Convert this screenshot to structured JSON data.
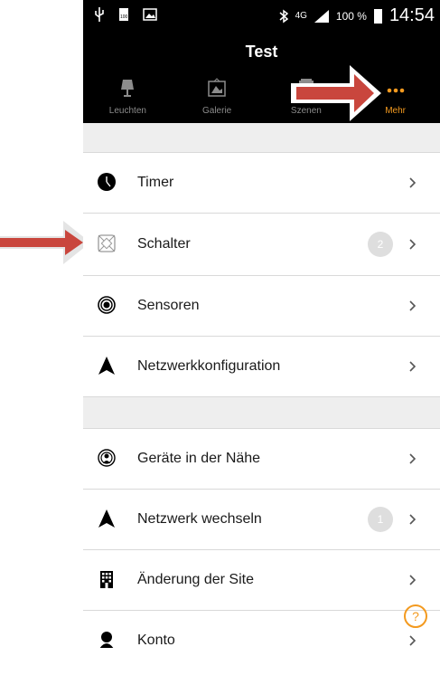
{
  "status": {
    "time": "14:54",
    "battery_percent": "100 %",
    "network": "4G",
    "battery_small": "100"
  },
  "appbar": {
    "title": "Test"
  },
  "tabs": [
    {
      "label": "Leuchten",
      "icon": "lamp-icon"
    },
    {
      "label": "Galerie",
      "icon": "gallery-icon"
    },
    {
      "label": "Szenen",
      "icon": "scenes-icon"
    },
    {
      "label": "Mehr",
      "icon": "more-icon"
    }
  ],
  "menu": {
    "section1": [
      {
        "label": "Timer",
        "icon": "timer-icon"
      },
      {
        "label": "Schalter",
        "icon": "switch-icon",
        "badge": "2"
      },
      {
        "label": "Sensoren",
        "icon": "sensor-icon"
      },
      {
        "label": "Netzwerkkonfiguration",
        "icon": "network-config-icon"
      }
    ],
    "section2": [
      {
        "label": "Geräte in der Nähe",
        "icon": "nearby-devices-icon"
      },
      {
        "label": "Netzwerk wechseln",
        "icon": "network-switch-icon",
        "badge": "1"
      },
      {
        "label": "Änderung der Site",
        "icon": "site-change-icon"
      },
      {
        "label": "Konto",
        "icon": "account-icon"
      }
    ]
  },
  "help": {
    "symbol": "?"
  },
  "colors": {
    "accent": "#f39a1f",
    "arrow": "#c9463d",
    "background_bar": "#000000",
    "gap": "#eeeeee"
  }
}
